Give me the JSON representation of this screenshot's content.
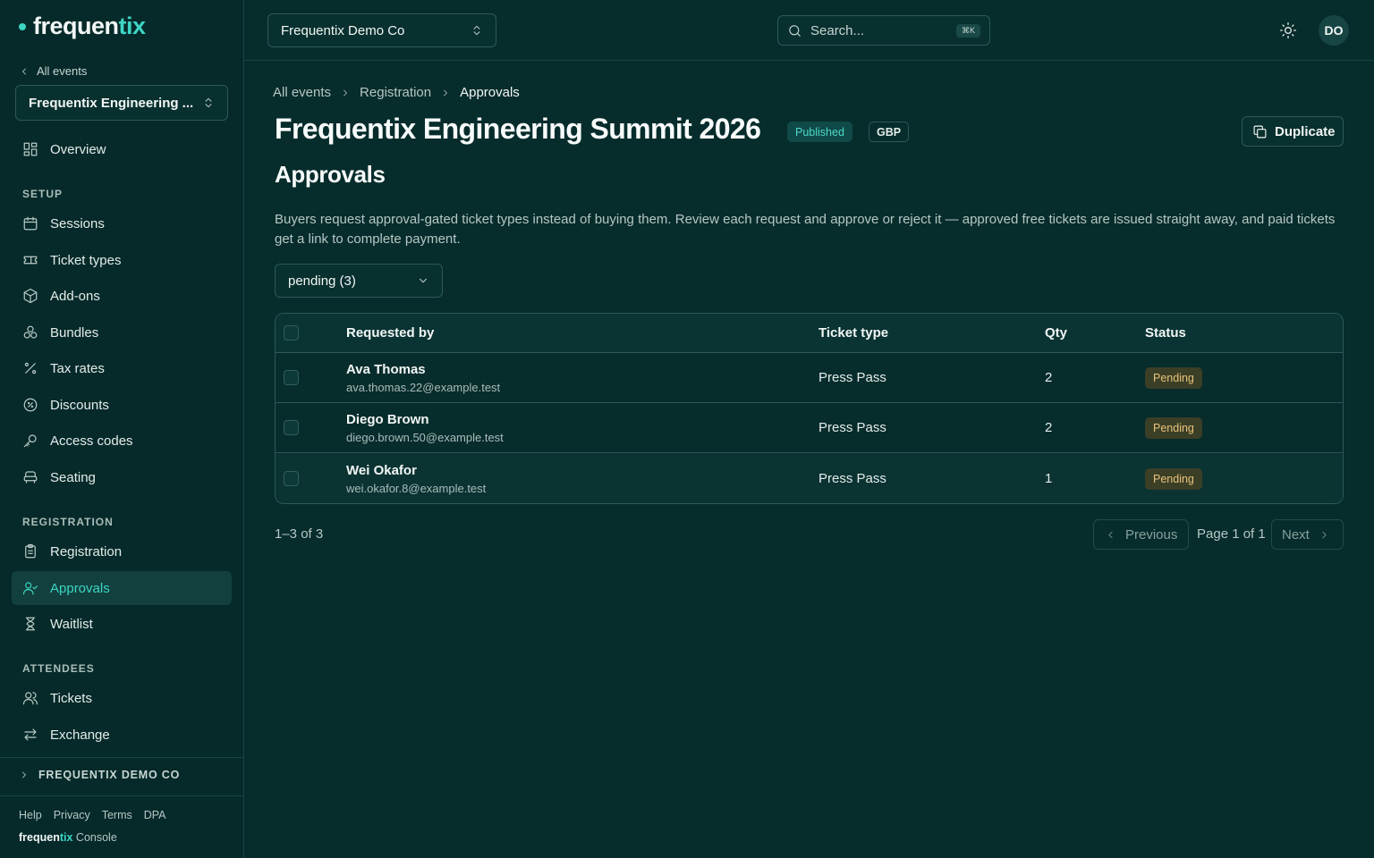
{
  "brand": {
    "name_main": "frequen",
    "name_accent": "tix",
    "accent_color": "#3dd6c4",
    "bg_color": "#072c2c"
  },
  "sidebar": {
    "back_label": "All events",
    "event_select": "Frequentix Engineering ...",
    "overview": "Overview",
    "sections": {
      "setup": "SETUP",
      "registration": "REGISTRATION",
      "attendees": "ATTENDEES"
    },
    "setup_items": [
      {
        "label": "Sessions",
        "icon": "calendar-icon"
      },
      {
        "label": "Ticket types",
        "icon": "ticket-icon"
      },
      {
        "label": "Add-ons",
        "icon": "box-icon"
      },
      {
        "label": "Bundles",
        "icon": "bundle-icon"
      },
      {
        "label": "Tax rates",
        "icon": "percent-icon"
      },
      {
        "label": "Discounts",
        "icon": "discount-icon"
      },
      {
        "label": "Access codes",
        "icon": "key-icon"
      },
      {
        "label": "Seating",
        "icon": "seat-icon"
      }
    ],
    "registration_items": [
      {
        "label": "Registration",
        "icon": "clipboard-icon"
      },
      {
        "label": "Approvals",
        "icon": "user-check-icon",
        "active": true
      },
      {
        "label": "Waitlist",
        "icon": "hourglass-icon"
      }
    ],
    "attendee_items": [
      {
        "label": "Tickets",
        "icon": "users-icon"
      },
      {
        "label": "Exchange",
        "icon": "exchange-icon"
      }
    ],
    "org_label": "FREQUENTIX DEMO CO",
    "footer_links": [
      "Help",
      "Privacy",
      "Terms",
      "DPA"
    ],
    "console_suffix": "Console"
  },
  "topbar": {
    "org_select": "Frequentix Demo Co",
    "search_placeholder": "Search...",
    "search_shortcut": "⌘K",
    "avatar_initials": "DO"
  },
  "main": {
    "breadcrumb": [
      "All events",
      "Registration",
      "Approvals"
    ],
    "event_title": "Frequentix Engineering Summit 2026",
    "status_badge": "Published",
    "currency_badge": "GBP",
    "duplicate_label": "Duplicate",
    "section_title": "Approvals",
    "description": "Buyers request approval-gated ticket types instead of buying them. Review each request and approve or reject it — approved free tickets are issued straight away, and paid tickets get a link to complete payment.",
    "filter_value": "pending (3)",
    "table": {
      "headers": {
        "requested_by": "Requested by",
        "ticket_type": "Ticket type",
        "qty": "Qty",
        "status": "Status"
      },
      "rows": [
        {
          "name": "Ava Thomas",
          "email": "ava.thomas.22@example.test",
          "ticket_type": "Press Pass",
          "qty": "2",
          "status": "Pending"
        },
        {
          "name": "Diego Brown",
          "email": "diego.brown.50@example.test",
          "ticket_type": "Press Pass",
          "qty": "2",
          "status": "Pending"
        },
        {
          "name": "Wei Okafor",
          "email": "wei.okafor.8@example.test",
          "ticket_type": "Press Pass",
          "qty": "1",
          "status": "Pending"
        }
      ]
    },
    "pagination": {
      "count": "1–3 of 3",
      "previous": "Previous",
      "page_info": "Page 1 of 1",
      "next": "Next"
    }
  }
}
